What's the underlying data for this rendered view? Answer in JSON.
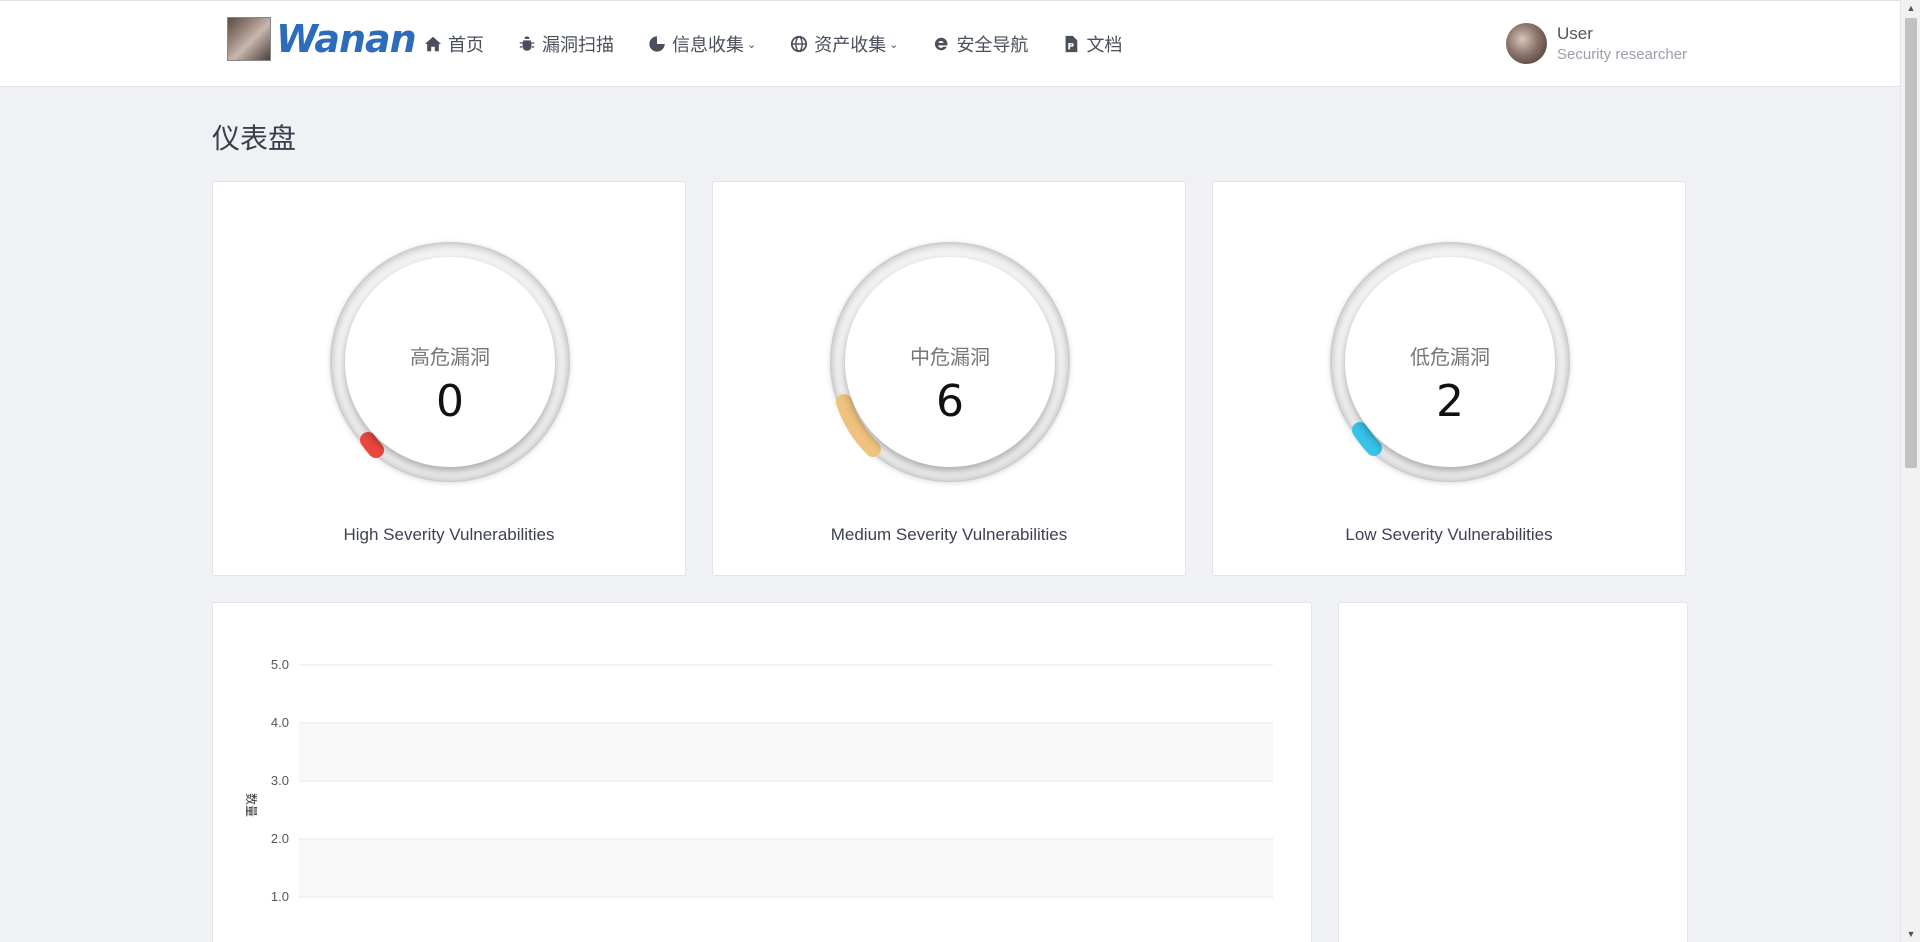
{
  "brand": {
    "name": "Wanan"
  },
  "nav": {
    "items": [
      {
        "label": "首页",
        "icon": "home-icon",
        "dropdown": false
      },
      {
        "label": "漏洞扫描",
        "icon": "bug-icon",
        "dropdown": false
      },
      {
        "label": "信息收集",
        "icon": "globe-pie-icon",
        "dropdown": true
      },
      {
        "label": "资产收集",
        "icon": "globe-icon",
        "dropdown": true
      },
      {
        "label": "安全导航",
        "icon": "ie-icon",
        "dropdown": false
      },
      {
        "label": "文档",
        "icon": "document-icon",
        "dropdown": false
      }
    ]
  },
  "user": {
    "name": "User",
    "role": "Security researcher"
  },
  "page": {
    "title": "仪表盘"
  },
  "gauges": [
    {
      "label": "高危漏洞",
      "value": "0",
      "caption": "High Severity Vulnerabilities",
      "color": "#e9473f"
    },
    {
      "label": "中危漏洞",
      "value": "6",
      "caption": "Medium Severity Vulnerabilities",
      "color": "#f0c27f"
    },
    {
      "label": "低危漏洞",
      "value": "2",
      "caption": "Low Severity Vulnerabilities",
      "color": "#39c2ea"
    }
  ],
  "chart_data": {
    "type": "line",
    "ylabel": "数量",
    "ylim": [
      1.0,
      5.0
    ],
    "yticks": [
      "5.0",
      "4.0",
      "3.0",
      "2.0",
      "1.0"
    ],
    "grid": true,
    "series": []
  },
  "colors": {
    "brand": "#2d6bbd",
    "background": "#f0f1f5"
  }
}
